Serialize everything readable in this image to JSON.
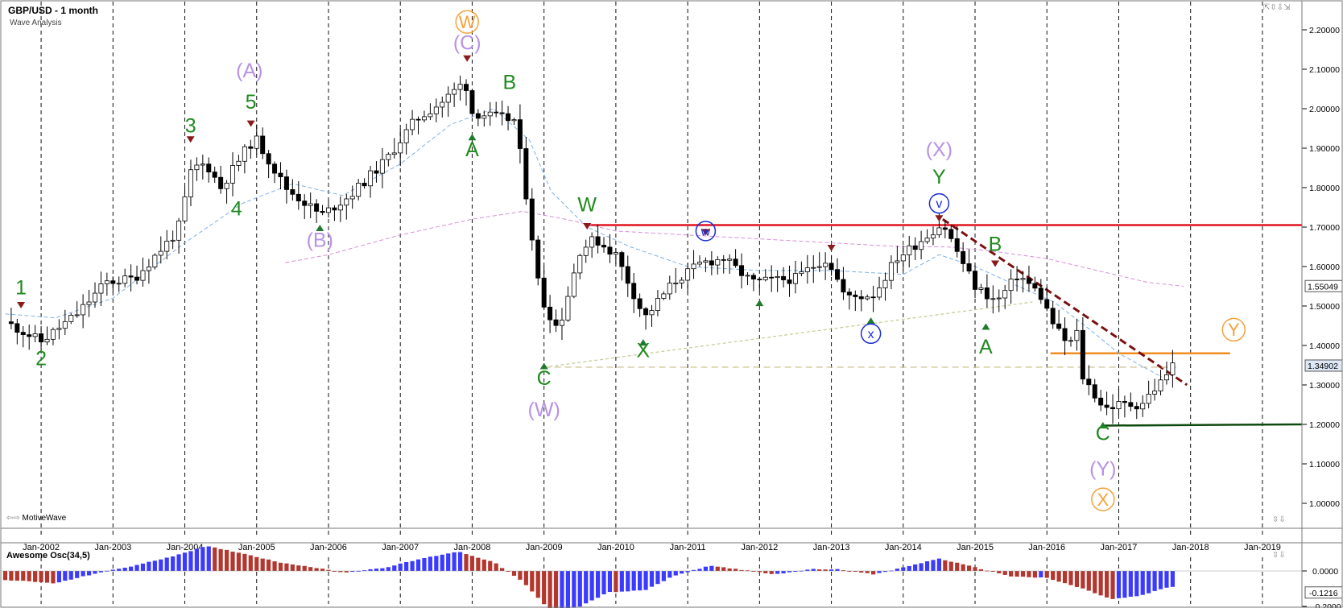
{
  "header": {
    "title": "GBP/USD - 1 month",
    "subtitle": "Wave Analysis",
    "watermark": "MotiveWave"
  },
  "oscillator": {
    "title": "Awesome Osc(34,5)"
  },
  "controls": {
    "top": "⇱⇳⇩⇲",
    "bottom": "⇳⇩",
    "osc": "⇳⇩"
  },
  "colors": {
    "bull": "#ffffff",
    "bear": "#000000",
    "up_bar": "#3b3bff",
    "down_bar": "#b3372f",
    "resistance": "#e0151f",
    "support": "#0f4a0f",
    "orange": "#f28c1f",
    "trend": "#7a1010",
    "green_label": "#1f8a1f",
    "purple_label": "#b892e6",
    "blue_label": "#1d2dd8",
    "orange_label": "#f5a13a"
  },
  "chart_data": [
    {
      "type": "candlestick",
      "title": "GBP/USD - 1 month",
      "subtitle": "Wave Analysis",
      "x_ticks": [
        "Jan-2002",
        "Jan-2003",
        "Jan-2004",
        "Jan-2005",
        "Jan-2006",
        "Jan-2007",
        "Jan-2008",
        "Jan-2009",
        "Jan-2010",
        "Jan-2011",
        "Jan-2012",
        "Jan-2013",
        "Jan-2014",
        "Jan-2015",
        "Jan-2016",
        "Jan-2017",
        "Jan-2018",
        "Jan-2019"
      ],
      "y_ticks": [
        "2.20000",
        "2.10000",
        "2.00000",
        "1.90000",
        "1.80000",
        "1.70000",
        "1.60000",
        "1.50000",
        "1.40000",
        "1.30000",
        "1.20000",
        "1.10000",
        "1.00000"
      ],
      "ylim": [
        0.94,
        2.24
      ],
      "xlim": [
        2001.45,
        2019.55
      ],
      "price_labels": [
        {
          "value": 1.55049,
          "text": "1.55049"
        },
        {
          "value": 1.34902,
          "text": "1.34902"
        }
      ],
      "anchors": [
        [
          2001.5,
          1.46
        ],
        [
          2002.0,
          1.41
        ],
        [
          2002.5,
          1.48
        ],
        [
          2002.9,
          1.56
        ],
        [
          2003.3,
          1.57
        ],
        [
          2003.6,
          1.63
        ],
        [
          2003.9,
          1.69
        ],
        [
          2004.1,
          1.85
        ],
        [
          2004.3,
          1.86
        ],
        [
          2004.5,
          1.8
        ],
        [
          2004.9,
          1.91
        ],
        [
          2005.0,
          1.92
        ],
        [
          2005.4,
          1.8
        ],
        [
          2005.9,
          1.73
        ],
        [
          2006.3,
          1.78
        ],
        [
          2006.8,
          1.87
        ],
        [
          2007.2,
          1.97
        ],
        [
          2007.6,
          2.02
        ],
        [
          2007.9,
          2.07
        ],
        [
          2008.0,
          1.99
        ],
        [
          2008.3,
          1.98
        ],
        [
          2008.6,
          1.97
        ],
        [
          2008.8,
          1.72
        ],
        [
          2008.95,
          1.52
        ],
        [
          2009.2,
          1.44
        ],
        [
          2009.5,
          1.64
        ],
        [
          2009.7,
          1.67
        ],
        [
          2010.0,
          1.63
        ],
        [
          2010.4,
          1.47
        ],
        [
          2010.8,
          1.56
        ],
        [
          2011.2,
          1.61
        ],
        [
          2011.5,
          1.62
        ],
        [
          2011.9,
          1.56
        ],
        [
          2012.5,
          1.57
        ],
        [
          2012.9,
          1.62
        ],
        [
          2013.0,
          1.6
        ],
        [
          2013.2,
          1.52
        ],
        [
          2013.6,
          1.53
        ],
        [
          2013.9,
          1.62
        ],
        [
          2014.2,
          1.66
        ],
        [
          2014.55,
          1.71
        ],
        [
          2014.8,
          1.62
        ],
        [
          2015.0,
          1.55
        ],
        [
          2015.3,
          1.51
        ],
        [
          2015.6,
          1.58
        ],
        [
          2015.9,
          1.53
        ],
        [
          2016.1,
          1.45
        ],
        [
          2016.3,
          1.4
        ],
        [
          2016.45,
          1.44
        ],
        [
          2016.5,
          1.32
        ],
        [
          2016.8,
          1.24
        ],
        [
          2017.0,
          1.25
        ],
        [
          2017.3,
          1.25
        ],
        [
          2017.6,
          1.31
        ],
        [
          2017.75,
          1.35
        ]
      ],
      "ma_fast": [
        [
          2001.5,
          1.48
        ],
        [
          2002.2,
          1.47
        ],
        [
          2003.0,
          1.52
        ],
        [
          2004.0,
          1.66
        ],
        [
          2004.8,
          1.76
        ],
        [
          2005.5,
          1.81
        ],
        [
          2006.2,
          1.78
        ],
        [
          2007.0,
          1.86
        ],
        [
          2007.7,
          1.96
        ],
        [
          2008.3,
          2.0
        ],
        [
          2008.8,
          1.92
        ],
        [
          2009.1,
          1.79
        ],
        [
          2009.6,
          1.7
        ],
        [
          2010.2,
          1.65
        ],
        [
          2011.0,
          1.6
        ],
        [
          2012.0,
          1.59
        ],
        [
          2013.0,
          1.59
        ],
        [
          2014.0,
          1.58
        ],
        [
          2014.5,
          1.63
        ],
        [
          2015.0,
          1.6
        ],
        [
          2015.6,
          1.55
        ],
        [
          2016.1,
          1.51
        ],
        [
          2016.6,
          1.44
        ],
        [
          2017.0,
          1.38
        ],
        [
          2017.6,
          1.32
        ]
      ],
      "ma_slow": [
        [
          2005.4,
          1.61
        ],
        [
          2006.0,
          1.63
        ],
        [
          2007.0,
          1.68
        ],
        [
          2008.0,
          1.72
        ],
        [
          2008.7,
          1.74
        ],
        [
          2009.3,
          1.72
        ],
        [
          2010.0,
          1.69
        ],
        [
          2011.0,
          1.68
        ],
        [
          2012.0,
          1.67
        ],
        [
          2013.0,
          1.66
        ],
        [
          2014.0,
          1.65
        ],
        [
          2014.6,
          1.65
        ],
        [
          2015.2,
          1.64
        ],
        [
          2016.0,
          1.62
        ],
        [
          2016.7,
          1.59
        ],
        [
          2017.4,
          1.56
        ],
        [
          2017.9,
          1.55
        ]
      ],
      "lines": [
        {
          "name": "resistance",
          "x1": 2009.6,
          "y1": 1.705,
          "x2": 2019.55,
          "y2": 1.705,
          "color": "#e0151f"
        },
        {
          "name": "orange-level",
          "x1": 2016.05,
          "y1": 1.38,
          "x2": 2018.55,
          "y2": 1.38,
          "color": "#f28c1f"
        },
        {
          "name": "support",
          "x1": 2016.8,
          "y1": 1.197,
          "x2": 2019.55,
          "y2": 1.2,
          "color": "#0f4a0f"
        },
        {
          "name": "downtrend",
          "x1": 2014.55,
          "y1": 1.72,
          "x2": 2017.95,
          "y2": 1.3,
          "color": "#7a1010",
          "dash": "9,5"
        },
        {
          "name": "dash-c-level",
          "x1": 2009.0,
          "y1": 1.345,
          "x2": 2017.8,
          "y2": 1.345,
          "color": "#d2c79a",
          "dash": "8,5"
        },
        {
          "name": "diag-c-b",
          "x1": 2009.0,
          "y1": 1.345,
          "x2": 2015.8,
          "y2": 1.51,
          "color": "#c6cf9a",
          "dash": "4,3"
        }
      ],
      "wave_labels": [
        {
          "text": "1",
          "x": 2001.72,
          "y": 1.53,
          "color": "#1f8a1f",
          "size": 25
        },
        {
          "text": "2",
          "x": 2002.0,
          "y": 1.35,
          "color": "#1f8a1f",
          "size": 25
        },
        {
          "text": "3",
          "x": 2004.08,
          "y": 1.94,
          "color": "#1f8a1f",
          "size": 25
        },
        {
          "text": "4",
          "x": 2004.72,
          "y": 1.73,
          "color": "#1f8a1f",
          "size": 25
        },
        {
          "text": "5",
          "x": 2004.92,
          "y": 2.0,
          "color": "#1f8a1f",
          "size": 25
        },
        {
          "text": "(A)",
          "x": 2004.9,
          "y": 2.08,
          "color": "#b892e6",
          "size": 25
        },
        {
          "text": "(B)",
          "x": 2005.88,
          "y": 1.65,
          "color": "#b892e6",
          "size": 25
        },
        {
          "text": "(C)",
          "x": 2007.93,
          "y": 2.15,
          "color": "#b892e6",
          "size": 25
        },
        {
          "text": "A",
          "x": 2008.0,
          "y": 1.88,
          "color": "#1f8a1f",
          "size": 25
        },
        {
          "text": "B",
          "x": 2008.52,
          "y": 2.05,
          "color": "#1f8a1f",
          "size": 25
        },
        {
          "text": "W",
          "x": 2009.6,
          "y": 1.74,
          "color": "#1f8a1f",
          "size": 25
        },
        {
          "text": "C",
          "x": 2009.0,
          "y": 1.3,
          "color": "#1f8a1f",
          "size": 25
        },
        {
          "text": "(W)",
          "x": 2009.0,
          "y": 1.22,
          "color": "#b892e6",
          "size": 25
        },
        {
          "text": "X",
          "x": 2010.38,
          "y": 1.37,
          "color": "#1f8a1f",
          "size": 25
        },
        {
          "text": "(X)",
          "x": 2014.5,
          "y": 1.88,
          "color": "#b892e6",
          "size": 25
        },
        {
          "text": "Y",
          "x": 2014.5,
          "y": 1.81,
          "color": "#1f8a1f",
          "size": 25
        },
        {
          "text": "B",
          "x": 2015.28,
          "y": 1.64,
          "color": "#1f8a1f",
          "size": 25
        },
        {
          "text": "A",
          "x": 2015.15,
          "y": 1.38,
          "color": "#1f8a1f",
          "size": 25
        },
        {
          "text": "C",
          "x": 2016.78,
          "y": 1.16,
          "color": "#1f8a1f",
          "size": 25
        },
        {
          "text": "(Y)",
          "x": 2016.78,
          "y": 1.07,
          "color": "#b892e6",
          "size": 25
        }
      ],
      "circle_labels": [
        {
          "text": "W",
          "x": 2007.93,
          "y": 2.22,
          "color": "#f5a13a",
          "r": 14,
          "size": 22
        },
        {
          "text": "w",
          "x": 2011.25,
          "y": 1.69,
          "color": "#1d2dd8",
          "r": 12,
          "size": 16
        },
        {
          "text": "v",
          "x": 2014.5,
          "y": 1.76,
          "color": "#1d2dd8",
          "r": 12,
          "size": 16
        },
        {
          "text": "x",
          "x": 2013.55,
          "y": 1.43,
          "color": "#1d2dd8",
          "r": 12,
          "size": 16
        },
        {
          "text": "Y",
          "x": 2018.6,
          "y": 1.44,
          "color": "#f5a13a",
          "r": 14,
          "size": 22
        },
        {
          "text": "X",
          "x": 2016.78,
          "y": 1.01,
          "color": "#f5a13a",
          "r": 14,
          "size": 22
        }
      ],
      "markers": [
        {
          "dir": "down",
          "x": 2001.72,
          "y": 1.5
        },
        {
          "dir": "down",
          "x": 2004.08,
          "y": 1.92
        },
        {
          "dir": "down",
          "x": 2004.92,
          "y": 1.96
        },
        {
          "dir": "down",
          "x": 2007.93,
          "y": 2.125
        },
        {
          "dir": "down",
          "x": 2009.6,
          "y": 1.7
        },
        {
          "dir": "down",
          "x": 2011.25,
          "y": 1.685
        },
        {
          "dir": "down",
          "x": 2013.0,
          "y": 1.645
        },
        {
          "dir": "down",
          "x": 2014.5,
          "y": 1.72
        },
        {
          "dir": "down",
          "x": 2015.28,
          "y": 1.605
        },
        {
          "dir": "up",
          "x": 2005.88,
          "y": 1.7
        },
        {
          "dir": "up",
          "x": 2008.0,
          "y": 1.93
        },
        {
          "dir": "up",
          "x": 2009.0,
          "y": 1.35
        },
        {
          "dir": "up",
          "x": 2010.38,
          "y": 1.41
        },
        {
          "dir": "up",
          "x": 2012.0,
          "y": 1.51
        },
        {
          "dir": "up",
          "x": 2013.55,
          "y": 1.465
        },
        {
          "dir": "up",
          "x": 2015.15,
          "y": 1.45
        },
        {
          "dir": "up",
          "x": 2016.78,
          "y": 1.2
        }
      ]
    },
    {
      "type": "bar",
      "title": "Awesome Osc(34,5)",
      "y_ticks": [
        "0.0000",
        "-0.2000"
      ],
      "value_label": "-0.1216",
      "ylim": [
        -0.27,
        0.16
      ],
      "anchors": [
        [
          2001.5,
          -0.05
        ],
        [
          2002.2,
          -0.07
        ],
        [
          2002.8,
          -0.01
        ],
        [
          2003.3,
          0.03
        ],
        [
          2003.8,
          0.08
        ],
        [
          2004.3,
          0.14
        ],
        [
          2004.8,
          0.1
        ],
        [
          2005.3,
          0.05
        ],
        [
          2005.8,
          0.02
        ],
        [
          2006.2,
          -0.01
        ],
        [
          2006.8,
          0.02
        ],
        [
          2007.3,
          0.07
        ],
        [
          2007.8,
          0.11
        ],
        [
          2008.3,
          0.05
        ],
        [
          2008.7,
          -0.06
        ],
        [
          2009.1,
          -0.23
        ],
        [
          2009.5,
          -0.2
        ],
        [
          2009.9,
          -0.12
        ],
        [
          2010.4,
          -0.11
        ],
        [
          2010.8,
          -0.03
        ],
        [
          2011.3,
          0.03
        ],
        [
          2011.7,
          0.01
        ],
        [
          2012.2,
          -0.02
        ],
        [
          2012.7,
          0.01
        ],
        [
          2013.1,
          0.01
        ],
        [
          2013.6,
          -0.02
        ],
        [
          2014.1,
          0.03
        ],
        [
          2014.5,
          0.07
        ],
        [
          2015.0,
          0.02
        ],
        [
          2015.5,
          -0.03
        ],
        [
          2016.0,
          -0.04
        ],
        [
          2016.5,
          -0.1
        ],
        [
          2016.9,
          -0.16
        ],
        [
          2017.3,
          -0.14
        ],
        [
          2017.7,
          -0.09
        ]
      ]
    }
  ]
}
